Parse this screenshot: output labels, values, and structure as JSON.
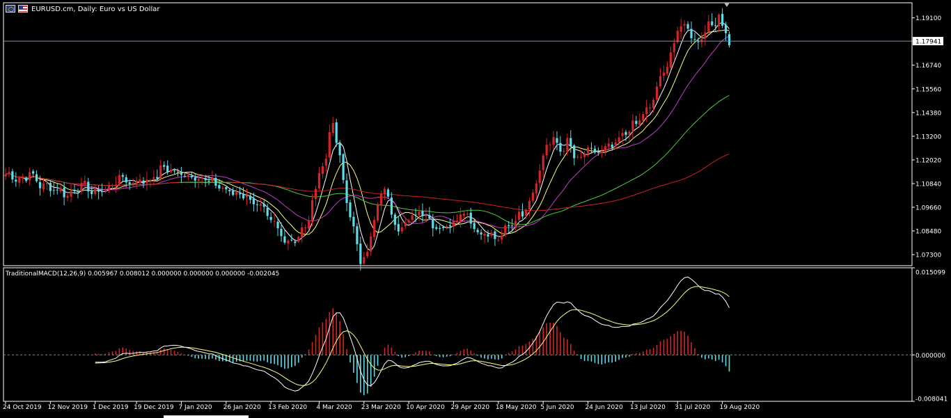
{
  "window": {
    "title": "EURUSD.cm, Daily:  Euro vs US Dollar",
    "icons": [
      "eu-flag-icon",
      "us-flag-icon"
    ]
  },
  "colors": {
    "background": "#000000",
    "grid": "#ffffff",
    "bull_candle": "#d32525",
    "bear_candle": "#5fdcea",
    "ma_fast": "#ffffff",
    "ma_yellow": "#ffff80",
    "ma_magenta": "#c23cc7",
    "ma_green": "#4ccc44",
    "ma_red": "#cc2222",
    "macd_line": "#ffffff",
    "signal_line": "#ffff80",
    "hist_up": "#d32525",
    "hist_down": "#5fdcea",
    "price_line": "#7c90b8"
  },
  "chart_data": [
    {
      "type": "candlestick",
      "title": "EURUSD.cm, Daily:  Euro vs US Dollar",
      "price_axis_ticks": [
        "1.19100",
        "1.17941",
        "1.16740",
        "1.15560",
        "1.14380",
        "1.13200",
        "1.12020",
        "1.10840",
        "1.09660",
        "1.08480",
        "1.07300"
      ],
      "ylim": [
        1.0675,
        1.1985
      ],
      "current_price": "1.17941",
      "date_axis_ticks": [
        "24 Oct 2019",
        "12 Nov 2019",
        "1 Dec 2019",
        "19 Dec 2019",
        "7 Jan 2020",
        "26 Jan 2020",
        "13 Feb 2020",
        "4 Mar 2020",
        "23 Mar 2020",
        "10 Apr 2020",
        "29 Apr 2020",
        "18 May 2020",
        "5 Jun 2020",
        "24 Jun 2020",
        "13 Jul 2020",
        "31 Jul 2020",
        "19 Aug 2020"
      ],
      "close_keypoints": [
        [
          0,
          1.113
        ],
        [
          5,
          1.1105
        ],
        [
          7,
          1.1135
        ],
        [
          10,
          1.108
        ],
        [
          14,
          1.106
        ],
        [
          18,
          1.103
        ],
        [
          22,
          1.1075
        ],
        [
          26,
          1.104
        ],
        [
          30,
          1.106
        ],
        [
          33,
          1.1115
        ],
        [
          36,
          1.109
        ],
        [
          40,
          1.11
        ],
        [
          43,
          1.111
        ],
        [
          46,
          1.1165
        ],
        [
          50,
          1.1135
        ],
        [
          54,
          1.1125
        ],
        [
          57,
          1.111
        ],
        [
          61,
          1.108
        ],
        [
          65,
          1.104
        ],
        [
          69,
          1.103
        ],
        [
          73,
          1.098
        ],
        [
          77,
          1.09
        ],
        [
          80,
          1.083
        ],
        [
          82,
          1.0795
        ],
        [
          84,
          1.081
        ],
        [
          87,
          1.086
        ],
        [
          89,
          1.098
        ],
        [
          91,
          1.115
        ],
        [
          93,
          1.12
        ],
        [
          94,
          1.135
        ],
        [
          95,
          1.138
        ],
        [
          97,
          1.12
        ],
        [
          99,
          1.1
        ],
        [
          101,
          1.085
        ],
        [
          103,
          1.07
        ],
        [
          105,
          1.075
        ],
        [
          107,
          1.09
        ],
        [
          109,
          1.102
        ],
        [
          110,
          1.108
        ],
        [
          112,
          1.093
        ],
        [
          114,
          1.087
        ],
        [
          116,
          1.088
        ],
        [
          118,
          1.092
        ],
        [
          121,
          1.095
        ],
        [
          124,
          1.088
        ],
        [
          127,
          1.086
        ],
        [
          130,
          1.09
        ],
        [
          133,
          1.095
        ],
        [
          135,
          1.09
        ],
        [
          137,
          1.084
        ],
        [
          140,
          1.083
        ],
        [
          143,
          1.08
        ],
        [
          146,
          1.088
        ],
        [
          149,
          1.092
        ],
        [
          152,
          1.1
        ],
        [
          155,
          1.115
        ],
        [
          157,
          1.128
        ],
        [
          159,
          1.13
        ],
        [
          161,
          1.125
        ],
        [
          163,
          1.129
        ],
        [
          165,
          1.122
        ],
        [
          167,
          1.12
        ],
        [
          169,
          1.126
        ],
        [
          171,
          1.123
        ],
        [
          173,
          1.125
        ],
        [
          175,
          1.126
        ],
        [
          177,
          1.128
        ],
        [
          179,
          1.132
        ],
        [
          181,
          1.136
        ],
        [
          183,
          1.138
        ],
        [
          185,
          1.143
        ],
        [
          187,
          1.146
        ],
        [
          189,
          1.156
        ],
        [
          191,
          1.164
        ],
        [
          193,
          1.173
        ],
        [
          195,
          1.184
        ],
        [
          197,
          1.188
        ],
        [
          199,
          1.183
        ],
        [
          201,
          1.178
        ],
        [
          203,
          1.186
        ],
        [
          205,
          1.187
        ],
        [
          207,
          1.193
        ],
        [
          208,
          1.187
        ],
        [
          210,
          1.1794
        ]
      ],
      "moving_averages": [
        "white",
        "yellow",
        "magenta",
        "green",
        "red"
      ]
    },
    {
      "type": "macd",
      "title": "TraditionalMACD(12,26,9) 0.005967 0.008012 0.000000 0.000000 0.000000 -0.002045",
      "axis_ticks": [
        "0.015099",
        "0.000000",
        "-0.008041"
      ],
      "ylim": [
        -0.008041,
        0.015099
      ],
      "zero_level": 0
    }
  ]
}
